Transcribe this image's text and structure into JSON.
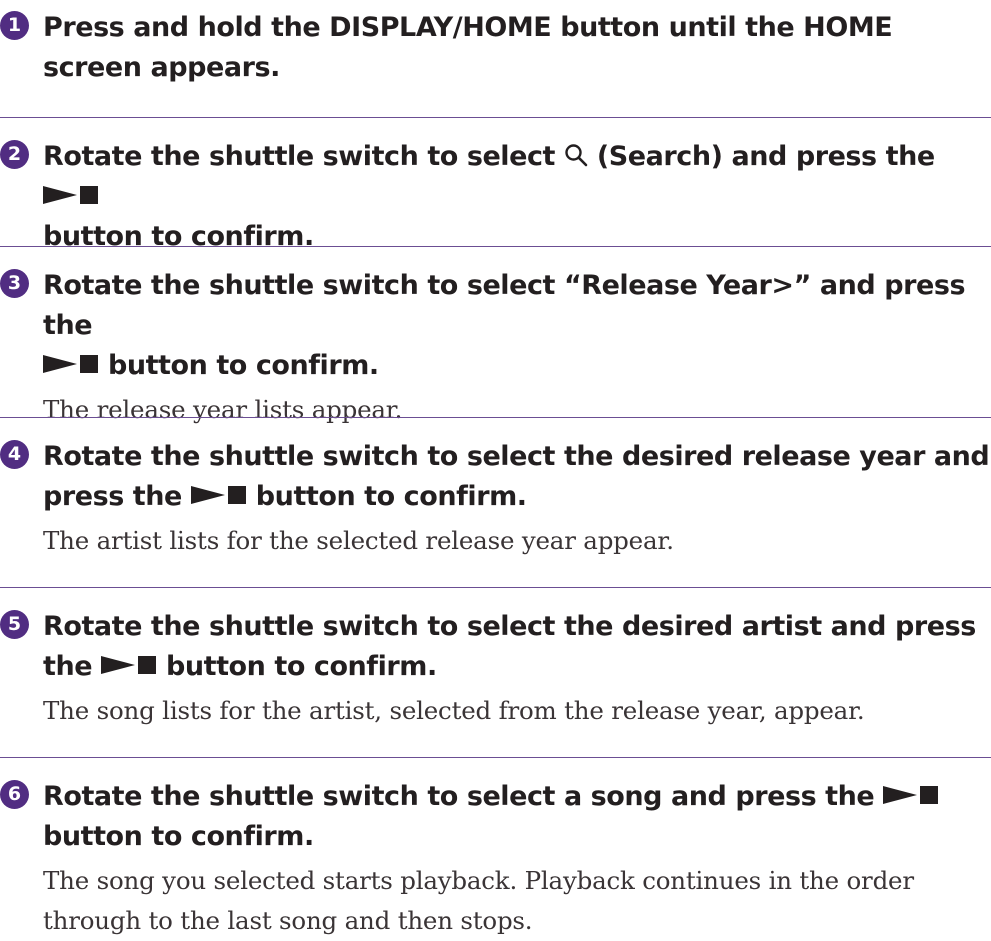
{
  "steps": [
    {
      "number": "1",
      "text": "Press and hold the DISPLAY/HOME button until the HOME screen appears."
    },
    {
      "number": "2",
      "text_a": "Rotate the shuttle switch to select ",
      "search_icon": "search-icon",
      "text_b": " (Search) and press the ",
      "play_stop_icon": "play-stop-icon",
      "text_c": " button to confirm."
    },
    {
      "number": "3",
      "text_a": "Rotate the shuttle switch to select “Release Year>” and press the ",
      "play_stop_icon": "play-stop-icon",
      "text_b": " button to confirm.",
      "result": "The release year lists appear."
    },
    {
      "number": "4",
      "text_a": "Rotate the shuttle switch to select the desired release year and press the ",
      "play_stop_icon": "play-stop-icon",
      "text_b": " button to confirm.",
      "result": "The artist lists for the selected release year appear."
    },
    {
      "number": "5",
      "text_a": "Rotate the shuttle switch to select the desired artist and press the ",
      "play_stop_icon": "play-stop-icon",
      "text_b": " button to confirm.",
      "result": "The song lists for the artist, selected from the release year, appear."
    },
    {
      "number": "6",
      "text_a": "Rotate the shuttle switch to select a song and press the ",
      "play_stop_icon": "play-stop-icon",
      "text_b": " button to confirm.",
      "result": "The song you selected starts playback. Playback continues in the order through to the last song and then stops."
    }
  ],
  "colors": {
    "accent": "#512d82",
    "divider": "#6b4e93",
    "text": "#231f20"
  }
}
